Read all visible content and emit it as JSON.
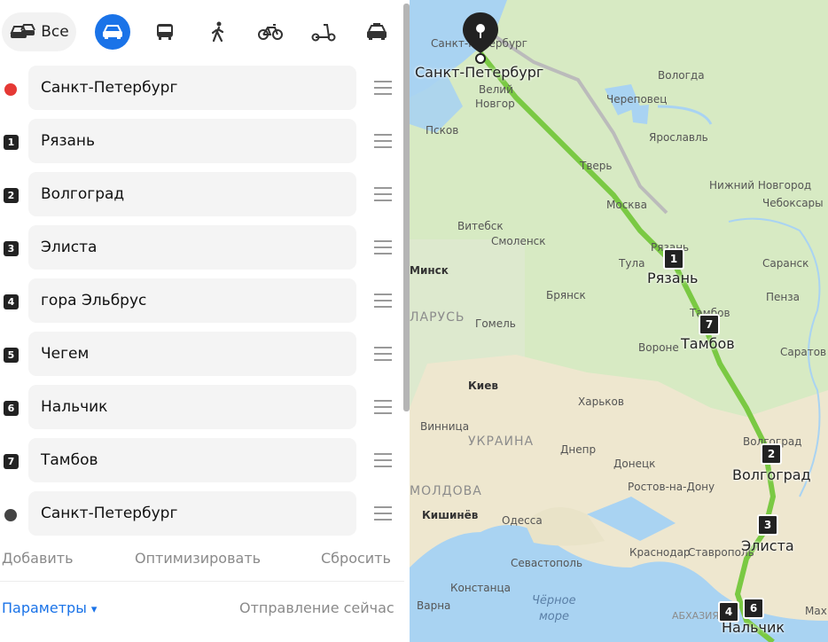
{
  "modes": {
    "all_label": "Все",
    "items": [
      "car-icon",
      "bus-icon",
      "walk-icon",
      "bike-icon",
      "scooter-icon",
      "taxi-icon"
    ]
  },
  "route": [
    {
      "marker": "",
      "type": "start",
      "value": "Санкт-Петербург"
    },
    {
      "marker": "1",
      "type": "num",
      "value": "Рязань"
    },
    {
      "marker": "2",
      "type": "num",
      "value": "Волгоград"
    },
    {
      "marker": "3",
      "type": "num",
      "value": "Элиста"
    },
    {
      "marker": "4",
      "type": "num",
      "value": "гора Эльбрус"
    },
    {
      "marker": "5",
      "type": "num",
      "value": "Чегем"
    },
    {
      "marker": "6",
      "type": "num",
      "value": "Нальчик"
    },
    {
      "marker": "7",
      "type": "num",
      "value": "Тамбов"
    },
    {
      "marker": "",
      "type": "end",
      "value": "Санкт-Петербург"
    }
  ],
  "actions": {
    "add": "Добавить",
    "optimize": "Оптимизировать",
    "reset": "Сбросить"
  },
  "bottom": {
    "params": "Параметры",
    "params_arrow": "▾",
    "departure": "Отправление сейчас"
  },
  "colors": {
    "accent": "#1a73e8",
    "start": "#e53935",
    "end": "#444444",
    "route": "#7ac943"
  },
  "map": {
    "big_labels": {
      "spb": "Санкт-Петербург",
      "ryazan": "Рязань",
      "tambov": "Тамбов",
      "volgograd": "Волгоград",
      "elista": "Элиста",
      "nalchik": "Нальчик"
    },
    "countries": {
      "belarus": "ЛАРУСЬ",
      "ukraine": "УКРАИНА",
      "moldova": "МОЛДОВА"
    },
    "sea": {
      "line1": "Чёрное",
      "line2": "море"
    },
    "abkhazia": "АБХАЗИЯ",
    "cities": {
      "spb_small": "Санкт-Петербург",
      "vologda": "Вологда",
      "cherepovets": "Череповец",
      "novgorod1": "Велий",
      "novgorod2": "Новгор",
      "pskov": "Псков",
      "yaroslavl": "Ярославль",
      "tver": "Тверь",
      "nnovgorod": "Нижний Новгород",
      "cheboksary": "Чебоксары",
      "moscow": "Москва",
      "vitebsk": "Витебск",
      "smolensk": "Смоленск",
      "minsk": "Минск",
      "tula": "Тула",
      "ryazan_small": "Рязань",
      "saransk": "Саранск",
      "penza": "Пенза",
      "bryansk": "Брянск",
      "gomel": "Гомель",
      "tambov_small": "Тамбов",
      "voronezh": "Вороне",
      "saratov": "Саратов",
      "kiev": "Киев",
      "kharkov": "Харьков",
      "vinnitsa": "Винница",
      "volgograd_small": "Волгоград",
      "dnepr": "Днепр",
      "donetsk": "Донецк",
      "rostov": "Ростов-на-Дону",
      "kishinev": "Кишинёв",
      "odessa": "Одесса",
      "krasnodar": "Краснодар",
      "stavropol": "Ставрополь",
      "sevastopol": "Севастополь",
      "constanta": "Констанца",
      "varna": "Варна",
      "makh": "Мах"
    },
    "waypoints": {
      "w1": "1",
      "w7": "7",
      "w2": "2",
      "w3": "3",
      "w4": "4",
      "w6": "6"
    }
  }
}
